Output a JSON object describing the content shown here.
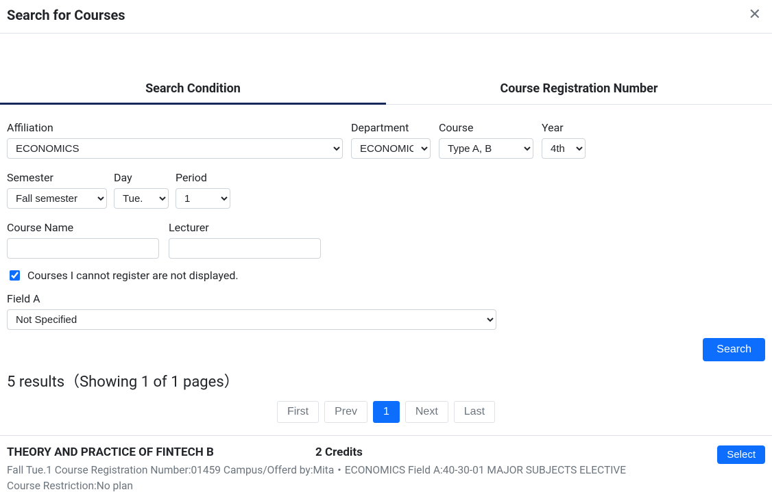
{
  "header": {
    "title": "Search for Courses"
  },
  "tabs": {
    "search_condition": "Search Condition",
    "course_reg_number": "Course Registration Number"
  },
  "labels": {
    "affiliation": "Affiliation",
    "department": "Department",
    "course": "Course",
    "year": "Year",
    "semester": "Semester",
    "day": "Day",
    "period": "Period",
    "course_name": "Course Name",
    "lecturer": "Lecturer",
    "field_a": "Field A",
    "checkbox": "Courses I cannot register are not displayed."
  },
  "values": {
    "affiliation": "ECONOMICS",
    "department": "ECONOMICS",
    "course": "Type A, B",
    "year": "4th",
    "semester": "Fall semester",
    "day": "Tue.",
    "period": "1",
    "field_a": "Not Specified",
    "course_name": "",
    "lecturer": ""
  },
  "buttons": {
    "search": "Search",
    "select": "Select"
  },
  "results": {
    "summary": "5 results（Showing 1 of 1 pages）"
  },
  "pagination": {
    "first": "First",
    "prev": "Prev",
    "page1": "1",
    "next": "Next",
    "last": "Last"
  },
  "result0": {
    "title": "THEORY AND PRACTICE OF FINTECH B",
    "credits": "2 Credits",
    "meta": "Fall   Tue.1   Course Registration Number:01459   Campus/Offerd by:Mita・ECONOMICS   Field A:40-30-01 MAJOR SUBJECTS ELECTIVE",
    "restriction": "Course Restriction:No plan"
  }
}
